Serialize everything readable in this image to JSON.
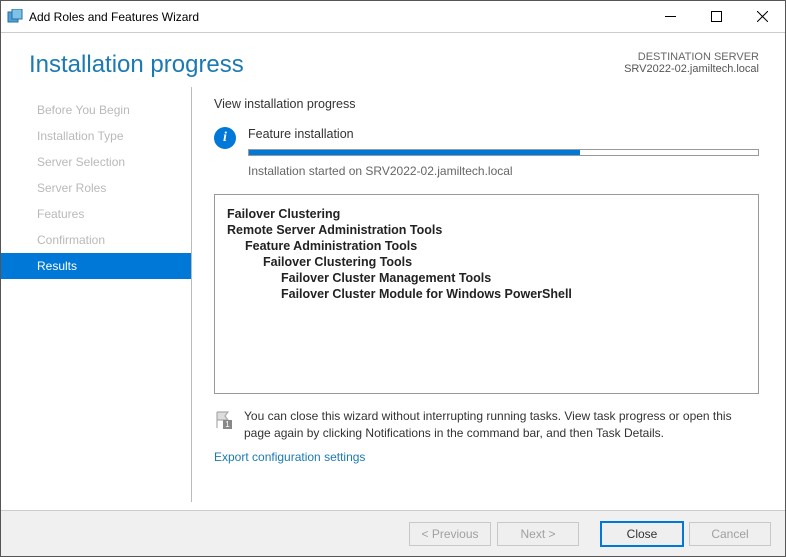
{
  "window": {
    "title": "Add Roles and Features Wizard"
  },
  "header": {
    "title": "Installation progress",
    "destination_label": "DESTINATION SERVER",
    "destination_value": "SRV2022-02.jamiltech.local"
  },
  "sidebar": {
    "items": [
      {
        "label": "Before You Begin",
        "active": false
      },
      {
        "label": "Installation Type",
        "active": false
      },
      {
        "label": "Server Selection",
        "active": false
      },
      {
        "label": "Server Roles",
        "active": false
      },
      {
        "label": "Features",
        "active": false
      },
      {
        "label": "Confirmation",
        "active": false
      },
      {
        "label": "Results",
        "active": true
      }
    ]
  },
  "main": {
    "section_title": "View installation progress",
    "feature_label": "Feature installation",
    "progress_percent": 65,
    "progress_message": "Installation started on SRV2022-02.jamiltech.local",
    "features": [
      {
        "text": "Failover Clustering",
        "level": 0,
        "bold": true
      },
      {
        "text": "Remote Server Administration Tools",
        "level": 0,
        "bold": true
      },
      {
        "text": "Feature Administration Tools",
        "level": 1,
        "bold": true
      },
      {
        "text": "Failover Clustering Tools",
        "level": 2,
        "bold": true
      },
      {
        "text": "Failover Cluster Management Tools",
        "level": 3,
        "bold": true
      },
      {
        "text": "Failover Cluster Module for Windows PowerShell",
        "level": 3,
        "bold": true
      }
    ],
    "note": "You can close this wizard without interrupting running tasks. View task progress or open this page again by clicking Notifications in the command bar, and then Task Details.",
    "export_link": "Export configuration settings"
  },
  "footer": {
    "previous": "< Previous",
    "next": "Next >",
    "close": "Close",
    "cancel": "Cancel"
  }
}
